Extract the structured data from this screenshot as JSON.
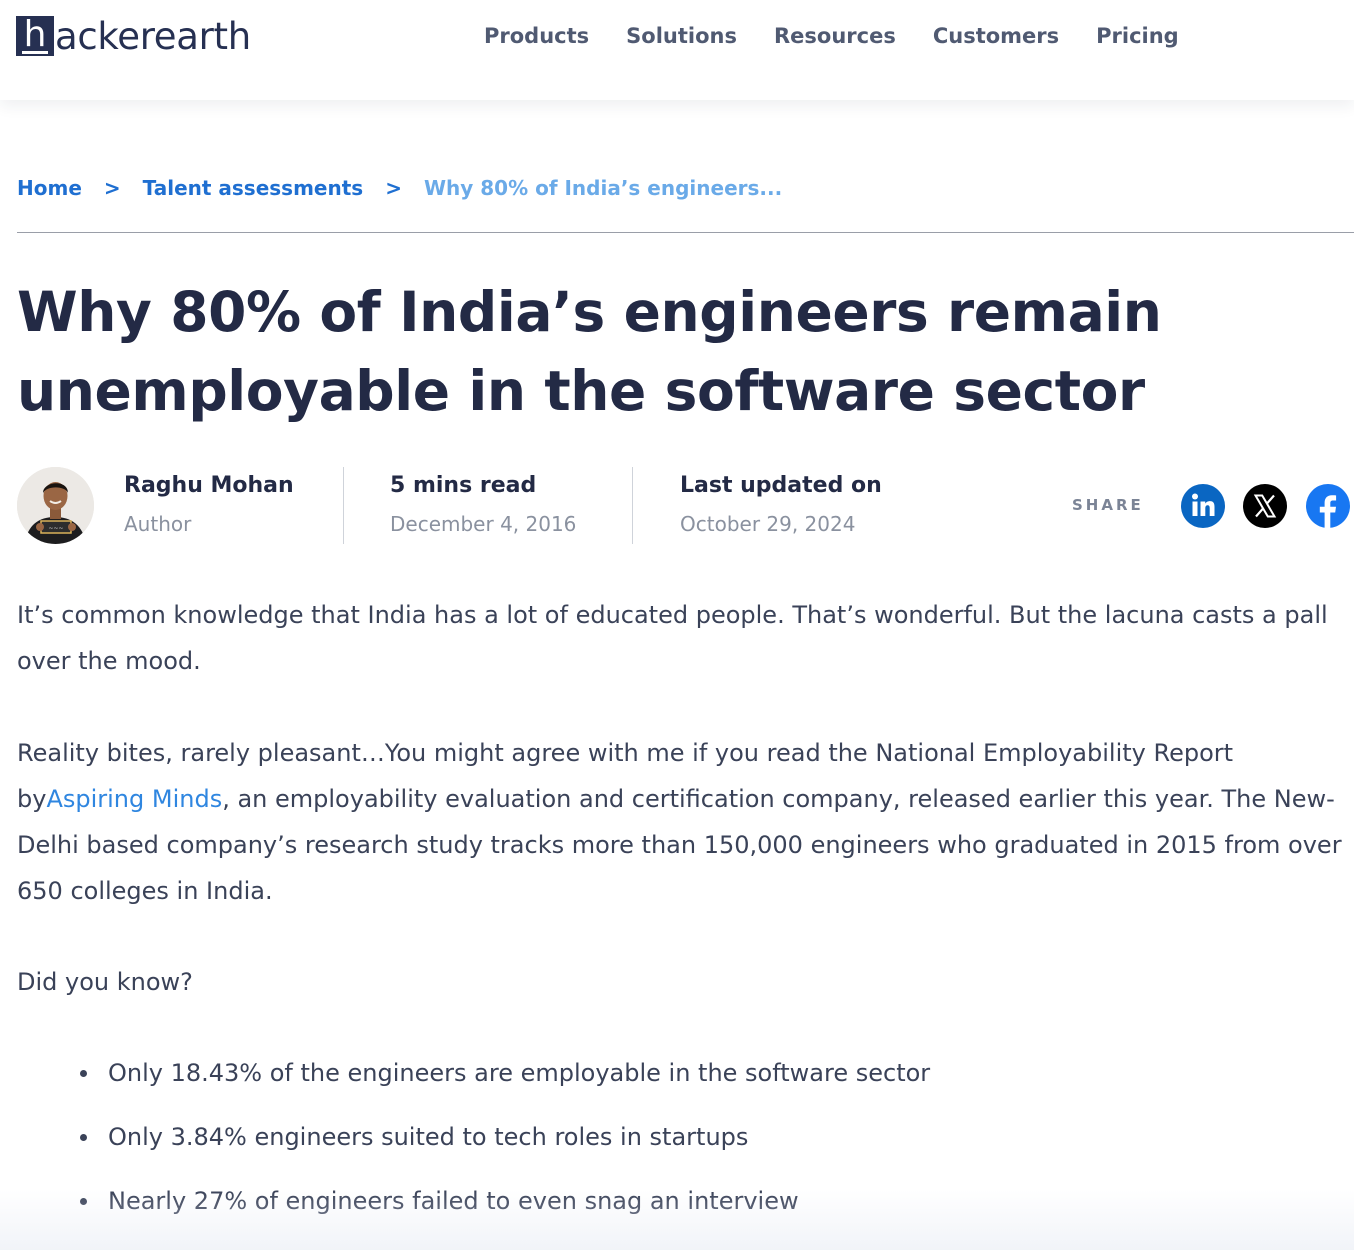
{
  "header": {
    "logo_mark": "h",
    "logo_text": "ackerearth",
    "nav": [
      "Products",
      "Solutions",
      "Resources",
      "Customers",
      "Pricing"
    ]
  },
  "breadcrumb": {
    "home": "Home",
    "separator": ">",
    "category": "Talent assessments",
    "current": "Why 80% of India’s engineers..."
  },
  "article": {
    "title_line1": "Why 80% of India’s engineers remain",
    "title_line2": "unemployable in the software sector",
    "author": {
      "name": "Raghu Mohan",
      "role": "Author"
    },
    "read_time": {
      "label": "5 mins read",
      "date": "December 4, 2016"
    },
    "updated": {
      "label": "Last updated on",
      "date": "October 29, 2024"
    },
    "share": {
      "label": "SHARE",
      "icons": [
        "linkedin-icon",
        "x-icon",
        "facebook-icon"
      ],
      "colors": {
        "linkedin": "#0a66c2",
        "x": "#000000",
        "facebook": "#1877f2"
      }
    },
    "p1": "It’s common knowledge that India has a lot of educated people. That’s wonderful. But the lacuna casts a pall over the mood.",
    "p2_before": "Reality bites, rarely pleasant…You might agree with me if you read the National Employability Report by",
    "p2_link": "Aspiring Minds",
    "p2_after": ", an employability evaluation and certification company, released earlier this year. The New-Delhi based company’s research study tracks more than 150,000 engineers who graduated in 2015 from over 650 colleges in India.",
    "p3": "Did you know?",
    "bullets": [
      "Only 18.43% of the engineers are employable in the software sector",
      "Only 3.84% engineers suited to tech roles in startups",
      "Nearly 27% of engineers failed to even snag an interview"
    ]
  },
  "colors": {
    "heading": "#232a45",
    "body_text": "#3a4258",
    "link": "#1f6fd1",
    "breadcrumb_current": "#6aaae8",
    "muted": "#8a919f"
  }
}
